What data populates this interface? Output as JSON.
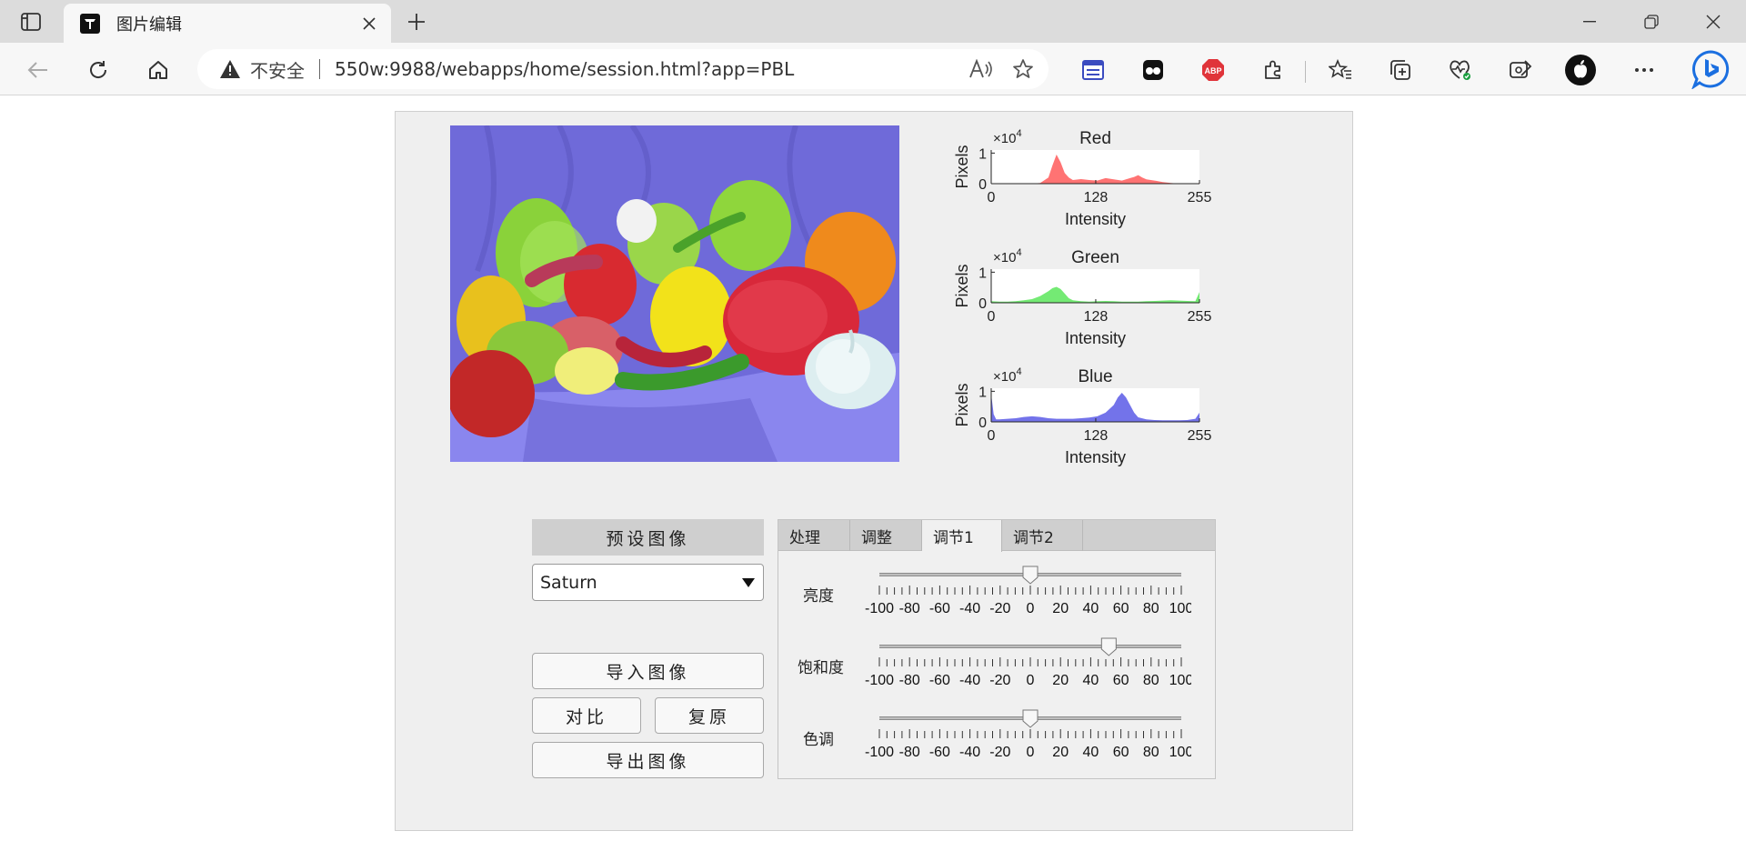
{
  "browser": {
    "tab_title": "图片编辑",
    "insecure_label": "不安全",
    "url": "550w:9988/webapps/home/session.html?app=PBL"
  },
  "app": {
    "preset_header": "预设图像",
    "preset_value": "Saturn",
    "buttons": {
      "import": "导入图像",
      "compare": "对比",
      "restore": "复原",
      "export": "导出图像"
    },
    "tabs": [
      "处理",
      "调整",
      "调节1",
      "调节2"
    ],
    "active_tab": "调节1",
    "sliders": [
      {
        "label": "亮度",
        "value": 0
      },
      {
        "label": "饱和度",
        "value": 52
      },
      {
        "label": "色调",
        "value": 0
      }
    ],
    "slider_ticks": [
      "-100",
      "-80",
      "-60",
      "-40",
      "-20",
      "0",
      "20",
      "40",
      "60",
      "80",
      "100"
    ],
    "colors": {
      "red": "#ff5a5a",
      "green": "#5ce65c",
      "blue": "#5a5ae6"
    }
  },
  "chart_data": [
    {
      "type": "area",
      "title": "Red",
      "xlabel": "Intensity",
      "ylabel": "Pixels",
      "y_exponent": "×10",
      "y_exponent_power": "4",
      "xlim": [
        0,
        255
      ],
      "ylim": [
        0,
        1.1
      ],
      "xticks": [
        "0",
        "128",
        "255"
      ],
      "yticks": [
        "0",
        "1"
      ],
      "color": "#ff5a5a",
      "x": [
        0,
        10,
        20,
        30,
        40,
        50,
        60,
        70,
        75,
        80,
        85,
        90,
        95,
        100,
        110,
        120,
        130,
        140,
        150,
        160,
        170,
        175,
        180,
        185,
        190,
        200,
        210,
        220,
        230,
        240,
        250,
        255
      ],
      "y": [
        0,
        0,
        0,
        0,
        0,
        0,
        0.02,
        0.2,
        0.6,
        0.95,
        0.7,
        0.35,
        0.2,
        0.12,
        0.15,
        0.12,
        0.1,
        0.18,
        0.14,
        0.1,
        0.18,
        0.22,
        0.28,
        0.2,
        0.14,
        0.1,
        0.05,
        0.02,
        0,
        0,
        0,
        0.02
      ]
    },
    {
      "type": "area",
      "title": "Green",
      "xlabel": "Intensity",
      "ylabel": "Pixels",
      "y_exponent": "×10",
      "y_exponent_power": "4",
      "xlim": [
        0,
        255
      ],
      "ylim": [
        0,
        1.1
      ],
      "xticks": [
        "0",
        "128",
        "255"
      ],
      "yticks": [
        "0",
        "1"
      ],
      "color": "#5ce65c",
      "x": [
        0,
        10,
        20,
        30,
        40,
        50,
        60,
        70,
        75,
        80,
        85,
        90,
        95,
        100,
        110,
        120,
        130,
        140,
        150,
        160,
        170,
        180,
        190,
        200,
        210,
        220,
        230,
        240,
        250,
        255
      ],
      "y": [
        0.05,
        0.04,
        0.04,
        0.05,
        0.08,
        0.12,
        0.22,
        0.38,
        0.48,
        0.52,
        0.45,
        0.3,
        0.15,
        0.08,
        0.05,
        0.04,
        0.05,
        0.06,
        0.05,
        0.04,
        0.04,
        0.04,
        0.05,
        0.06,
        0.07,
        0.08,
        0.07,
        0.06,
        0.05,
        0.35
      ]
    },
    {
      "type": "area",
      "title": "Blue",
      "xlabel": "Intensity",
      "ylabel": "Pixels",
      "y_exponent": "×10",
      "y_exponent_power": "4",
      "xlim": [
        0,
        255
      ],
      "ylim": [
        0,
        1.1
      ],
      "xticks": [
        "0",
        "128",
        "255"
      ],
      "yticks": [
        "0",
        "1"
      ],
      "color": "#5a5ae6",
      "x": [
        0,
        3,
        6,
        10,
        20,
        30,
        40,
        50,
        60,
        70,
        80,
        90,
        100,
        110,
        120,
        130,
        140,
        150,
        155,
        160,
        165,
        170,
        175,
        180,
        190,
        200,
        210,
        220,
        230,
        240,
        250,
        255
      ],
      "y": [
        0.9,
        0.25,
        0.08,
        0.08,
        0.1,
        0.12,
        0.16,
        0.18,
        0.16,
        0.12,
        0.1,
        0.1,
        0.1,
        0.12,
        0.14,
        0.18,
        0.3,
        0.55,
        0.8,
        0.95,
        0.8,
        0.55,
        0.3,
        0.15,
        0.08,
        0.06,
        0.05,
        0.05,
        0.05,
        0.06,
        0.1,
        0.3
      ]
    }
  ]
}
